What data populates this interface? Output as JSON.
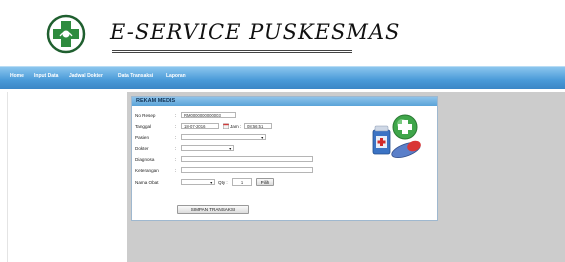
{
  "app": {
    "title": "E-SERVICE PUSKESMAS"
  },
  "nav": {
    "items": [
      "Home",
      "Input Data",
      "Jadwal Dokter",
      "Data Transaksi",
      "Laporan"
    ]
  },
  "form": {
    "title": "REKAM MEDIS",
    "colon": ":",
    "no_resep": {
      "label": "No Resep",
      "value": "RM0000000000003"
    },
    "tanggal": {
      "label": "Tanggal",
      "value": "18-07-2016",
      "jam_label": "Jam :",
      "jam_value": "08:56:51"
    },
    "pasien": {
      "label": "Pasien",
      "value": ""
    },
    "dokter": {
      "label": "Dokter",
      "value": ""
    },
    "diagnosa": {
      "label": "Diagnosa",
      "value": ""
    },
    "keterangan": {
      "label": "Keterangan",
      "value": ""
    },
    "nama_obat": {
      "label": "Nama Obat",
      "value": "",
      "qty_label": "Qty :",
      "qty_value": "1",
      "pilih_label": "Pilih"
    },
    "submit_label": "SIMPAN TRANSAKSI"
  },
  "icons": {
    "logo": "cross-logo-icon",
    "calendar": "calendar-icon",
    "illustration": "medicine-icon"
  },
  "colors": {
    "nav": "#4a9ad8",
    "panel_header": "#7ab8e4",
    "background": "#cccccc",
    "logo_green": "#2e8b3e"
  }
}
